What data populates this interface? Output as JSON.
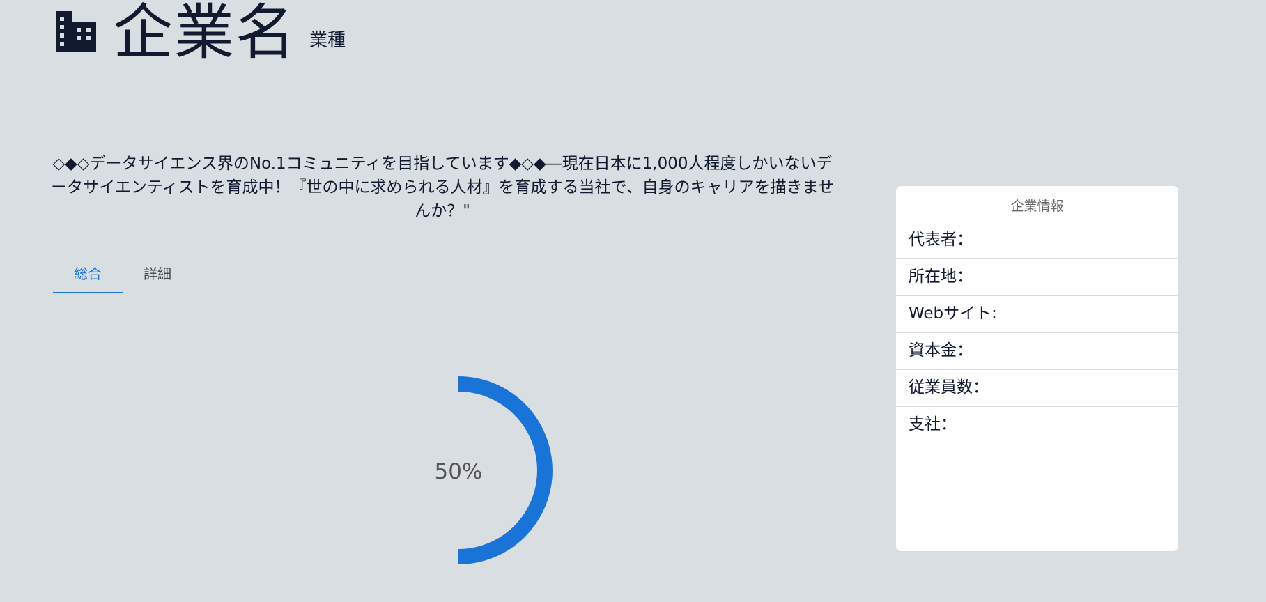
{
  "header": {
    "icon": "building-icon",
    "company_name": "企業名",
    "industry": "業種"
  },
  "description": "◇◆◇データサイエンス界のNo.1コミュニティを目指しています◆◇◆―現在日本に1,000人程度しかいないデータサイエンティストを育成中！『世の中に求められる人材』を育成する当社で、自身のキャリアを描きませんか？\"",
  "tabs": [
    {
      "label": "総合",
      "active": true
    },
    {
      "label": "詳細",
      "active": false
    }
  ],
  "gauge": {
    "value": 0.5,
    "label": "50%",
    "color": "#1a74d8"
  },
  "info_card": {
    "title": "企業情報",
    "rows": [
      {
        "label": "代表者："
      },
      {
        "label": "所在地："
      },
      {
        "label": "Webサイト:"
      },
      {
        "label": "資本金："
      },
      {
        "label": "従業員数："
      },
      {
        "label": "支社："
      }
    ]
  }
}
